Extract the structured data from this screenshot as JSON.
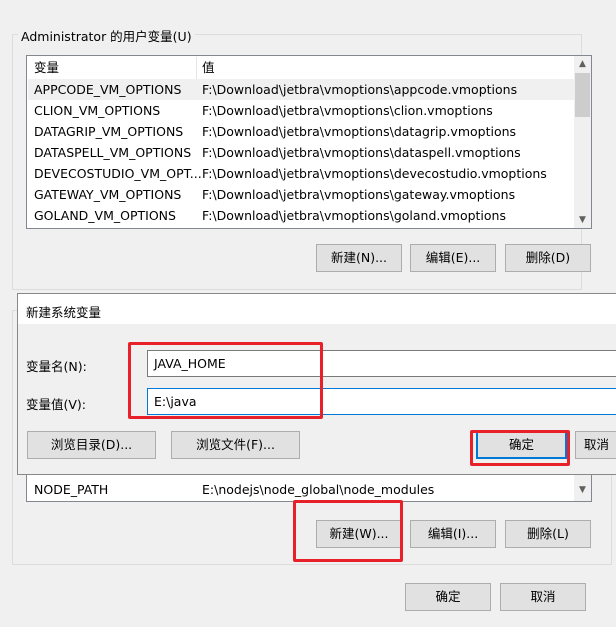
{
  "user_vars": {
    "group_label": "Administrator 的用户变量(U)",
    "columns": [
      "变量",
      "值"
    ],
    "rows": [
      {
        "name": "APPCODE_VM_OPTIONS",
        "value": "F:\\Download\\jetbra\\vmoptions\\appcode.vmoptions"
      },
      {
        "name": "CLION_VM_OPTIONS",
        "value": "F:\\Download\\jetbra\\vmoptions\\clion.vmoptions"
      },
      {
        "name": "DATAGRIP_VM_OPTIONS",
        "value": "F:\\Download\\jetbra\\vmoptions\\datagrip.vmoptions"
      },
      {
        "name": "DATASPELL_VM_OPTIONS",
        "value": "F:\\Download\\jetbra\\vmoptions\\dataspell.vmoptions"
      },
      {
        "name": "DEVECOSTUDIO_VM_OPT...",
        "value": "F:\\Download\\jetbra\\vmoptions\\devecostudio.vmoptions"
      },
      {
        "name": "GATEWAY_VM_OPTIONS",
        "value": "F:\\Download\\jetbra\\vmoptions\\gateway.vmoptions"
      },
      {
        "name": "GOLAND_VM_OPTIONS",
        "value": "F:\\Download\\jetbra\\vmoptions\\goland.vmoptions"
      }
    ],
    "buttons": {
      "new": "新建(N)...",
      "edit": "编辑(E)...",
      "delete": "删除(D)"
    }
  },
  "dialog": {
    "title": "新建系统变量",
    "name_label": "变量名(N):",
    "name_value": "JAVA_HOME",
    "value_label": "变量值(V):",
    "value_value": "E:\\java",
    "browse_dir": "浏览目录(D)...",
    "browse_file": "浏览文件(F)...",
    "ok": "确定",
    "cancel": "取消"
  },
  "system_vars": {
    "rows": [
      {
        "name": "NODE_PATH",
        "value": "E:\\nodejs\\node_global\\node_modules"
      }
    ],
    "buttons": {
      "new": "新建(W)...",
      "edit": "编辑(I)...",
      "delete": "删除(L)"
    }
  },
  "footer": {
    "ok": "确定",
    "cancel": "取消"
  }
}
